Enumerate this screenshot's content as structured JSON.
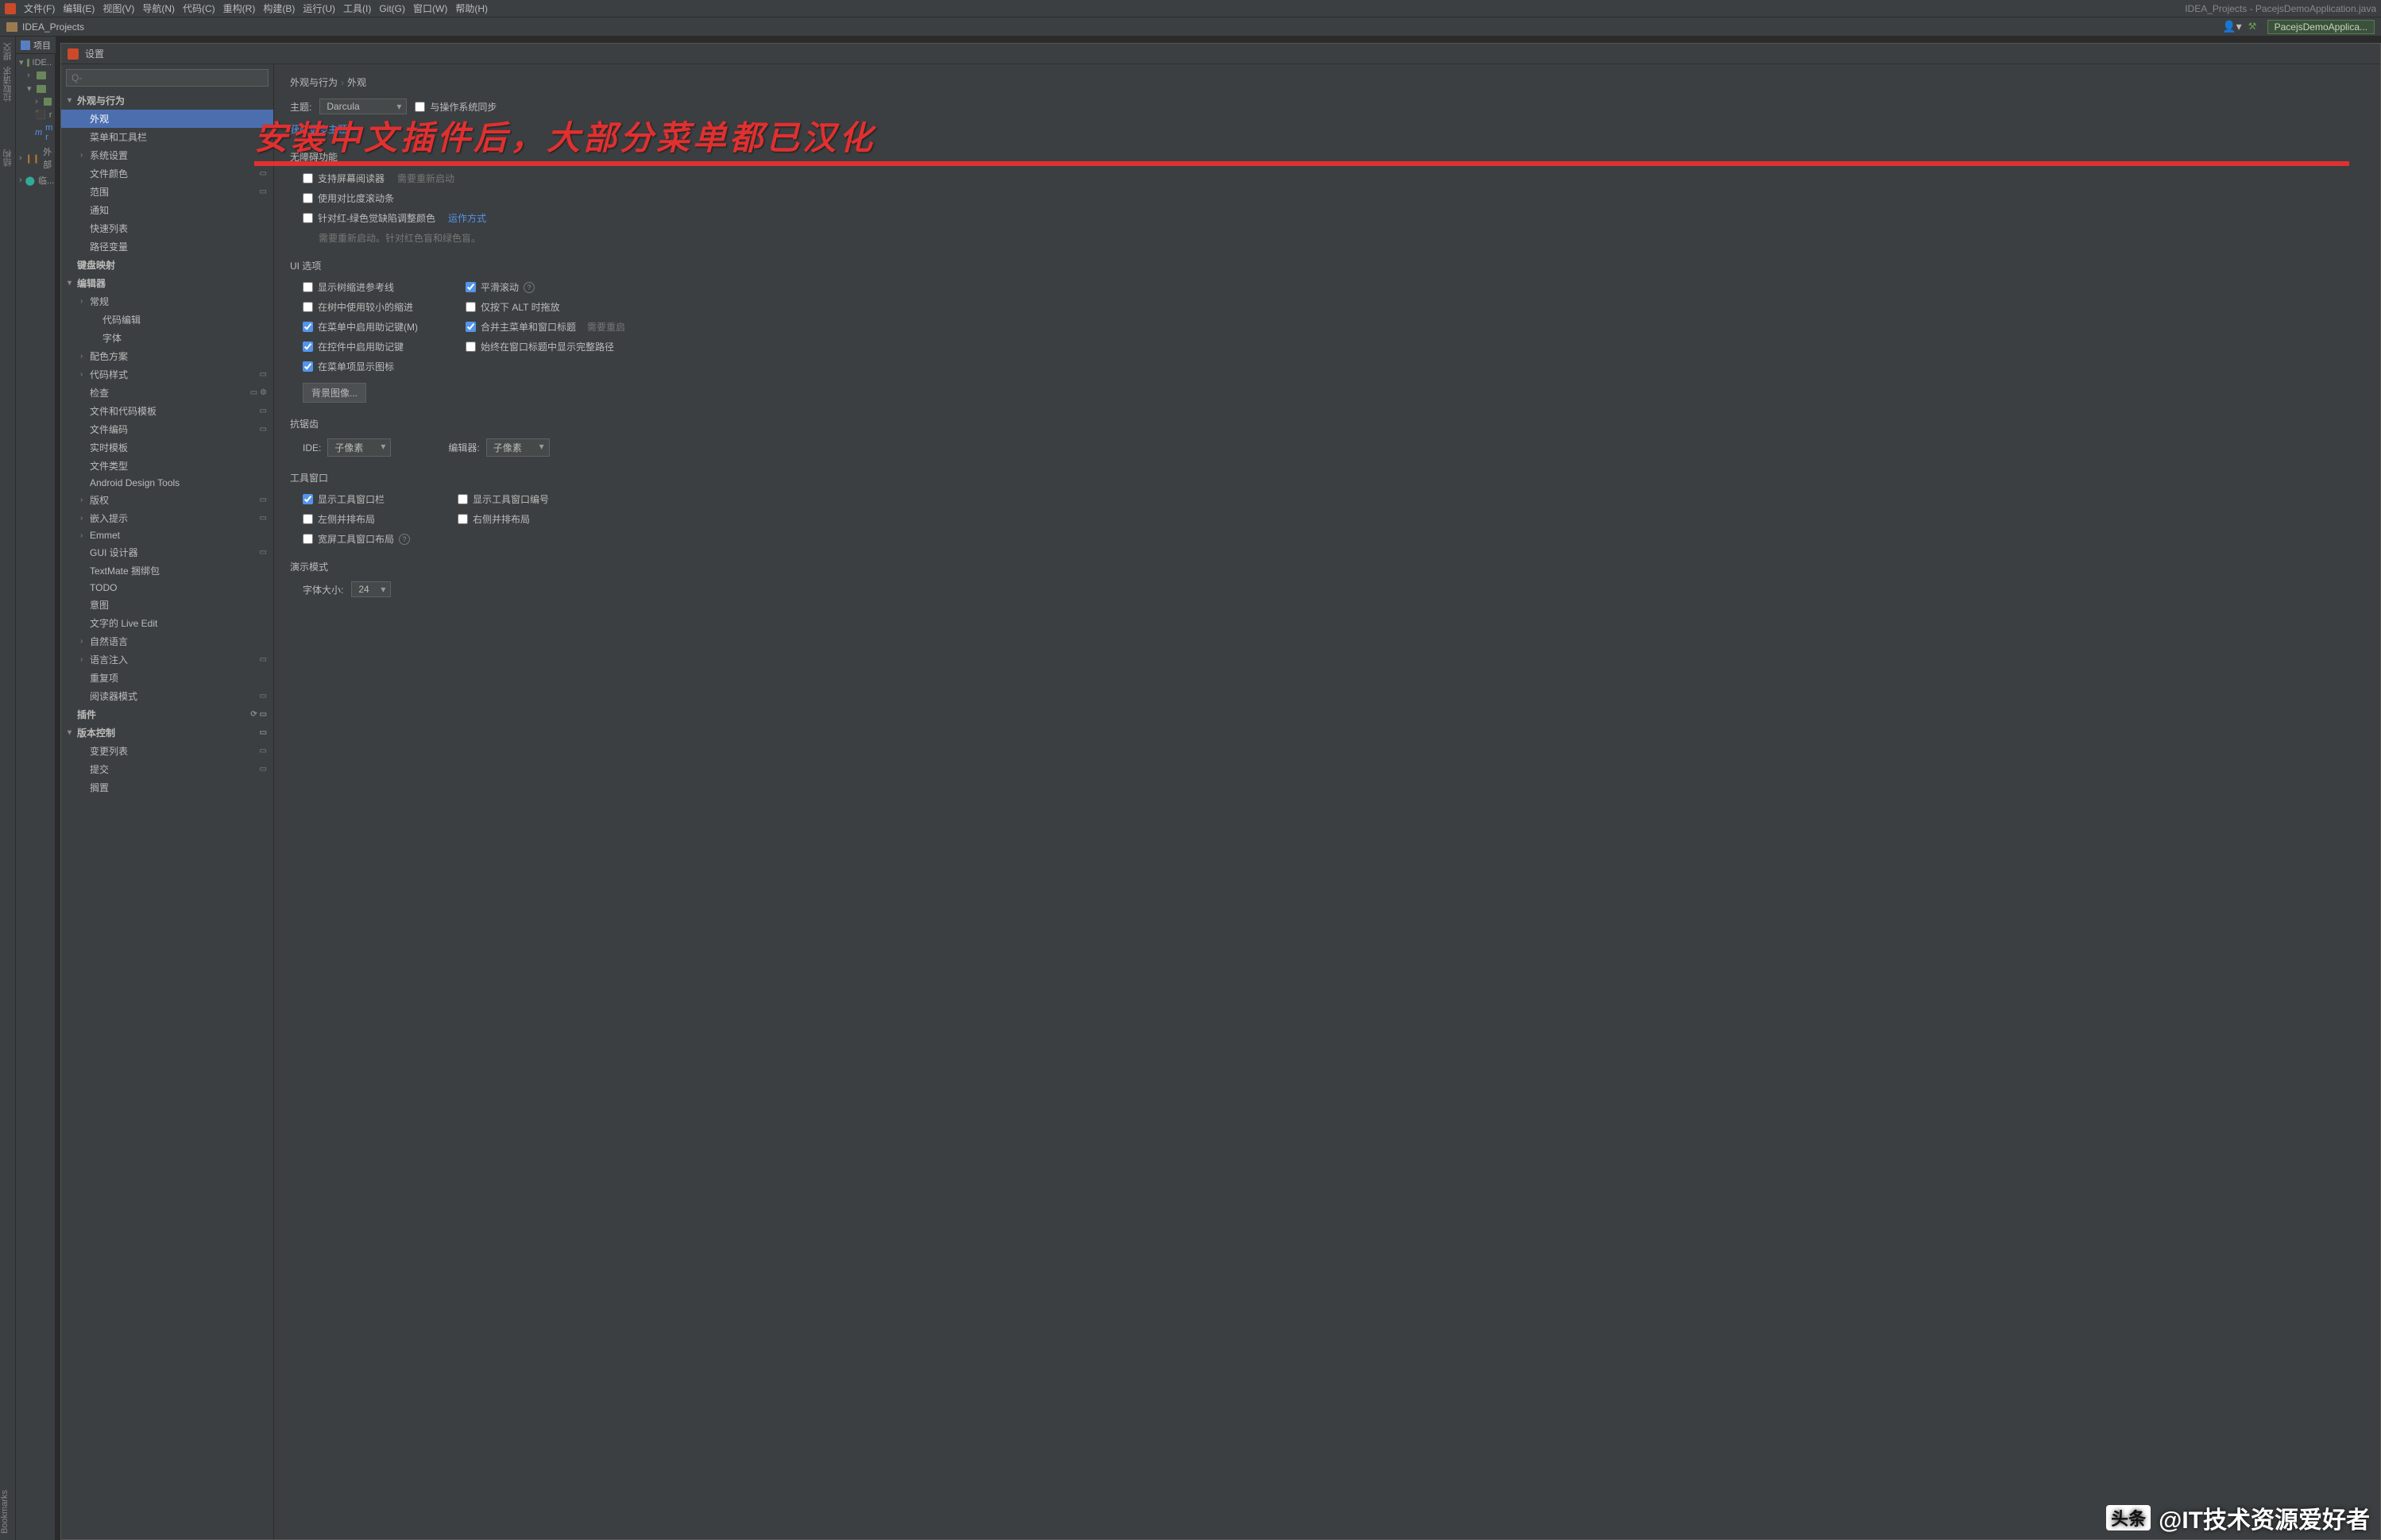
{
  "menubar": {
    "items": [
      "文件(F)",
      "编辑(E)",
      "视图(V)",
      "导航(N)",
      "代码(C)",
      "重构(R)",
      "构建(B)",
      "运行(U)",
      "工具(I)",
      "Git(G)",
      "窗口(W)",
      "帮助(H)"
    ],
    "title": "IDEA_Projects - PacejsDemoApplication.java"
  },
  "toolbar2": {
    "crumb": "IDEA_Projects",
    "run_config": "PacejsDemoApplica..."
  },
  "left_gutter": {
    "labels": [
      "提交",
      "拉取请求",
      "结构"
    ]
  },
  "proj_header": "项目",
  "project_strip": {
    "items": [
      {
        "chev": "▾",
        "label": "IDE.."
      },
      {
        "chev": "›",
        "label": ""
      },
      {
        "chev": "▾",
        "label": ""
      },
      {
        "chev": "›",
        "label": ""
      },
      {
        "chev": "",
        "label": "r"
      },
      {
        "chev": "",
        "label": "m r",
        "blue": true
      },
      {
        "chev": "›",
        "label": "外部"
      },
      {
        "chev": "›",
        "label": "临..."
      }
    ]
  },
  "bookmarks": "Bookmarks",
  "dialog": {
    "title": "设置"
  },
  "search_placeholder": "Q-",
  "tree": [
    {
      "lbl": "外观与行为",
      "bold": true,
      "chev": "▾",
      "indent": 0
    },
    {
      "lbl": "外观",
      "indent": 1,
      "selected": true
    },
    {
      "lbl": "菜单和工具栏",
      "indent": 1
    },
    {
      "lbl": "系统设置",
      "indent": 1,
      "chev": "›"
    },
    {
      "lbl": "文件颜色",
      "indent": 1,
      "badge": "▭"
    },
    {
      "lbl": "范围",
      "indent": 1,
      "badge": "▭"
    },
    {
      "lbl": "通知",
      "indent": 1
    },
    {
      "lbl": "快速列表",
      "indent": 1
    },
    {
      "lbl": "路径变量",
      "indent": 1
    },
    {
      "lbl": "键盘映射",
      "bold": true,
      "indent": 0
    },
    {
      "lbl": "编辑器",
      "bold": true,
      "chev": "▾",
      "indent": 0
    },
    {
      "lbl": "常规",
      "indent": 1,
      "chev": "›"
    },
    {
      "lbl": "代码编辑",
      "indent": 2
    },
    {
      "lbl": "字体",
      "indent": 2
    },
    {
      "lbl": "配色方案",
      "indent": 1,
      "chev": "›"
    },
    {
      "lbl": "代码样式",
      "indent": 1,
      "chev": "›",
      "badge": "▭"
    },
    {
      "lbl": "检查",
      "indent": 1,
      "badge": "▭ ⚙"
    },
    {
      "lbl": "文件和代码模板",
      "indent": 1,
      "badge": "▭"
    },
    {
      "lbl": "文件编码",
      "indent": 1,
      "badge": "▭"
    },
    {
      "lbl": "实时模板",
      "indent": 1
    },
    {
      "lbl": "文件类型",
      "indent": 1
    },
    {
      "lbl": "Android Design Tools",
      "indent": 1
    },
    {
      "lbl": "版权",
      "indent": 1,
      "chev": "›",
      "badge": "▭"
    },
    {
      "lbl": "嵌入提示",
      "indent": 1,
      "chev": "›",
      "badge": "▭"
    },
    {
      "lbl": "Emmet",
      "indent": 1,
      "chev": "›"
    },
    {
      "lbl": "GUI 设计器",
      "indent": 1,
      "badge": "▭"
    },
    {
      "lbl": "TextMate 捆绑包",
      "indent": 1
    },
    {
      "lbl": "TODO",
      "indent": 1
    },
    {
      "lbl": "意图",
      "indent": 1
    },
    {
      "lbl": "文字的 Live Edit",
      "indent": 1
    },
    {
      "lbl": "自然语言",
      "indent": 1,
      "chev": "›"
    },
    {
      "lbl": "语言注入",
      "indent": 1,
      "chev": "›",
      "badge": "▭"
    },
    {
      "lbl": "重复项",
      "indent": 1
    },
    {
      "lbl": "阅读器模式",
      "indent": 1,
      "badge": "▭"
    },
    {
      "lbl": "插件",
      "bold": true,
      "indent": 0,
      "badge": "⟳ ▭"
    },
    {
      "lbl": "版本控制",
      "bold": true,
      "chev": "▾",
      "indent": 0,
      "badge": "▭"
    },
    {
      "lbl": "变更列表",
      "indent": 1,
      "badge": "▭"
    },
    {
      "lbl": "提交",
      "indent": 1,
      "badge": "▭"
    },
    {
      "lbl": "搁置",
      "indent": 1
    }
  ],
  "content": {
    "crumb1": "外观与行为",
    "crumb2": "外观",
    "theme_label": "主题:",
    "theme_value": "Darcula",
    "sync_os": "与操作系统同步",
    "more_themes": "获取更多主题",
    "accessibility_header": "无障碍功能",
    "screen_reader": "支持屏幕阅读器",
    "screen_reader_hint": "需要重新启动",
    "contrast_scroll": "使用对比度滚动条",
    "color_deficiency": "针对红-绿色觉缺陷调整颜色",
    "how_it_works": "运作方式",
    "color_def_hint": "需要重新启动。针对红色盲和绿色盲。",
    "ui_options": "UI 选项",
    "left_opts": [
      {
        "lbl": "显示树缩进参考线",
        "chk": false
      },
      {
        "lbl": "在树中使用较小的缩进",
        "chk": false
      },
      {
        "lbl": "在菜单中启用助记键(M)",
        "chk": true
      },
      {
        "lbl": "在控件中启用助记键",
        "chk": true
      },
      {
        "lbl": "在菜单项显示图标",
        "chk": true
      }
    ],
    "right_opts": [
      {
        "lbl": "平滑滚动",
        "chk": true,
        "help": true
      },
      {
        "lbl": "仅按下 ALT 时拖放",
        "chk": false
      },
      {
        "lbl": "合并主菜单和窗口标题",
        "chk": true,
        "hint": "需要重启"
      },
      {
        "lbl": "始终在窗口标题中显示完整路径",
        "chk": false
      }
    ],
    "bg_image_btn": "背景图像...",
    "antialias": "抗锯齿",
    "ide_lbl": "IDE:",
    "ide_val": "子像素",
    "editor_lbl": "编辑器:",
    "editor_val": "子像素",
    "tool_windows": "工具窗口",
    "tw_opts_left": [
      {
        "lbl": "显示工具窗口栏",
        "chk": true
      },
      {
        "lbl": "左侧并排布局",
        "chk": false
      },
      {
        "lbl": "宽屏工具窗口布局",
        "chk": false,
        "help": true
      }
    ],
    "tw_opts_right": [
      {
        "lbl": "显示工具窗口编号",
        "chk": false
      },
      {
        "lbl": "右侧并排布局",
        "chk": false
      }
    ],
    "present_mode": "演示模式",
    "font_size_lbl": "字体大小:",
    "font_size_val": "24"
  },
  "annotation": "安装中文插件后，大部分菜单都已汉化",
  "watermark": {
    "logo": "头条",
    "text": "@IT技术资源爱好者"
  }
}
